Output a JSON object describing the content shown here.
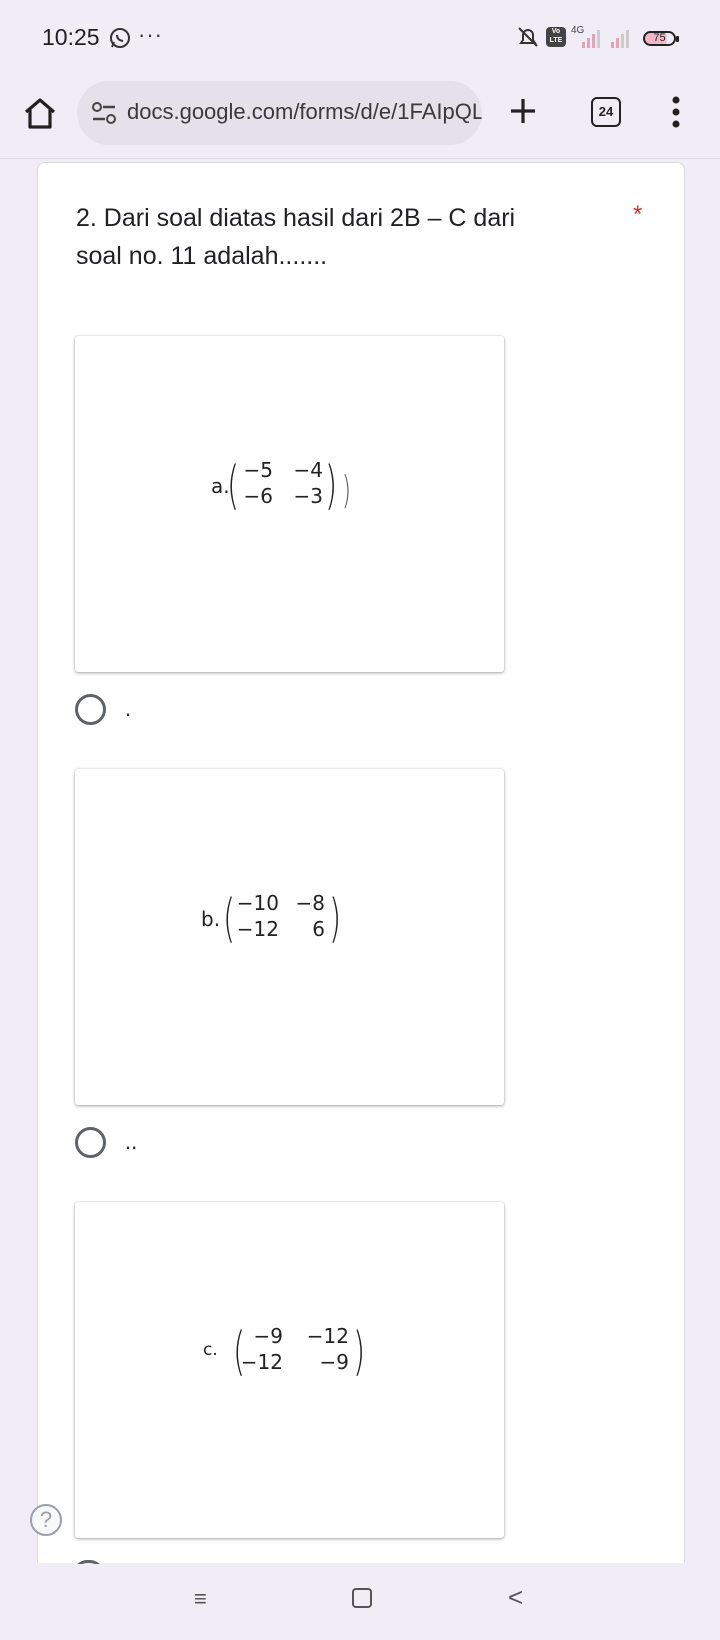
{
  "status_bar": {
    "time": "10:25",
    "more_dots": "···",
    "network_label": "4G",
    "volte_label": "Vo LTE",
    "battery": "75"
  },
  "browser": {
    "url": "docs.google.com/forms/d/e/1FAIpQL",
    "tab_count": "24"
  },
  "question": {
    "text": "2. Dari soal diatas hasil dari  2B – C  dari soal no. 11  adalah.......",
    "required_marker": "*"
  },
  "options": [
    {
      "label": ".",
      "image_matrix": {
        "prefix": "a.",
        "cells": [
          "−5",
          "−4",
          "−6",
          "−3"
        ]
      }
    },
    {
      "label": "..",
      "image_matrix": {
        "prefix": "b.",
        "cells": [
          "−10",
          "−8",
          "−12",
          "6"
        ]
      }
    },
    {
      "label": "",
      "image_matrix": {
        "prefix": "c.",
        "cells": [
          "−9",
          "−12",
          "−12",
          "−9"
        ]
      }
    }
  ],
  "help": {
    "symbol": "?"
  },
  "nav": {
    "recent": "≡",
    "back": "<"
  },
  "colors": {
    "accent_required": "#d93025",
    "background": "#f1edf7"
  }
}
